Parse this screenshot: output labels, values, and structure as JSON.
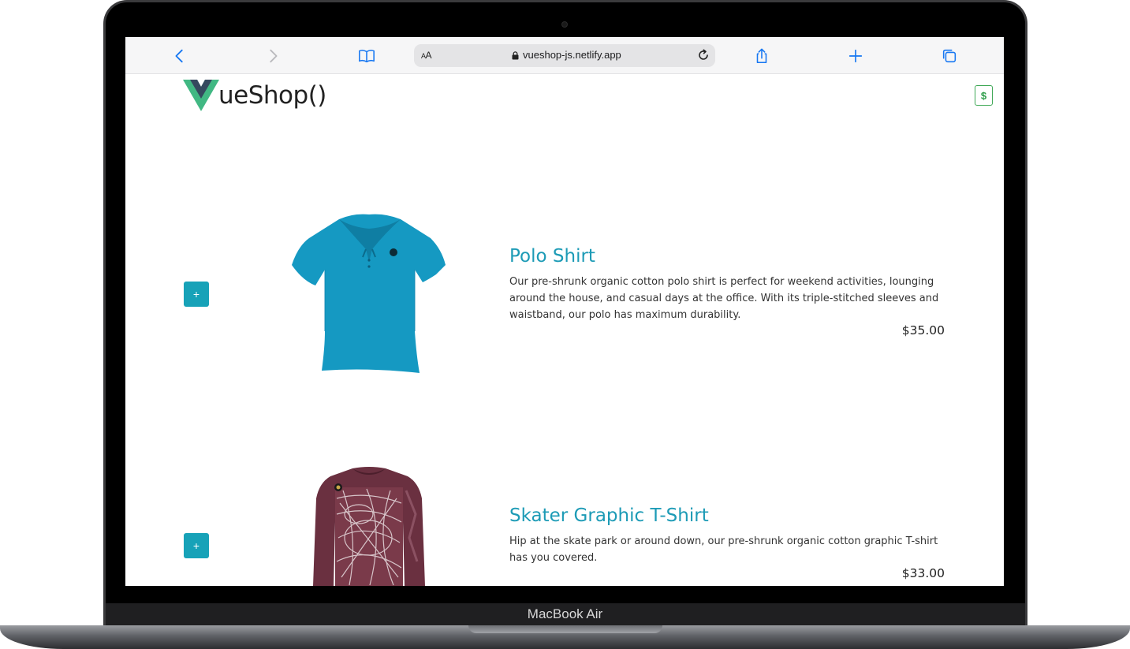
{
  "device": {
    "model_label": "MacBook Air"
  },
  "browser": {
    "back_icon": "chevron-left-icon",
    "forward_icon": "chevron-right-icon",
    "bookmarks_icon": "book-icon",
    "text_size_label_small": "A",
    "text_size_label_large": "A",
    "url": "vueshop-js.netlify.app",
    "reload_icon": "reload-icon",
    "share_icon": "share-icon",
    "new_tab_icon": "plus-icon",
    "tabs_icon": "tabs-icon",
    "accent_color": "#1677f2"
  },
  "app": {
    "logo_text": "ueShop()",
    "cart_button_label": "$",
    "accent_color": "#17a2b8",
    "products": [
      {
        "name": "Polo Shirt",
        "description": "Our pre-shrunk organic cotton polo shirt is perfect for weekend activities, lounging around the house, and casual days at the office. With its triple-stitched sleeves and waistband, our polo has maximum durability.",
        "price": "$35.00",
        "add_label": "+",
        "image_color": "#1599c2"
      },
      {
        "name": "Skater Graphic T-Shirt",
        "description": "Hip at the skate park or around down, our pre-shrunk organic cotton graphic T-shirt has you covered.",
        "price": "$33.00",
        "add_label": "+",
        "image_color": "#6a3040"
      }
    ]
  }
}
